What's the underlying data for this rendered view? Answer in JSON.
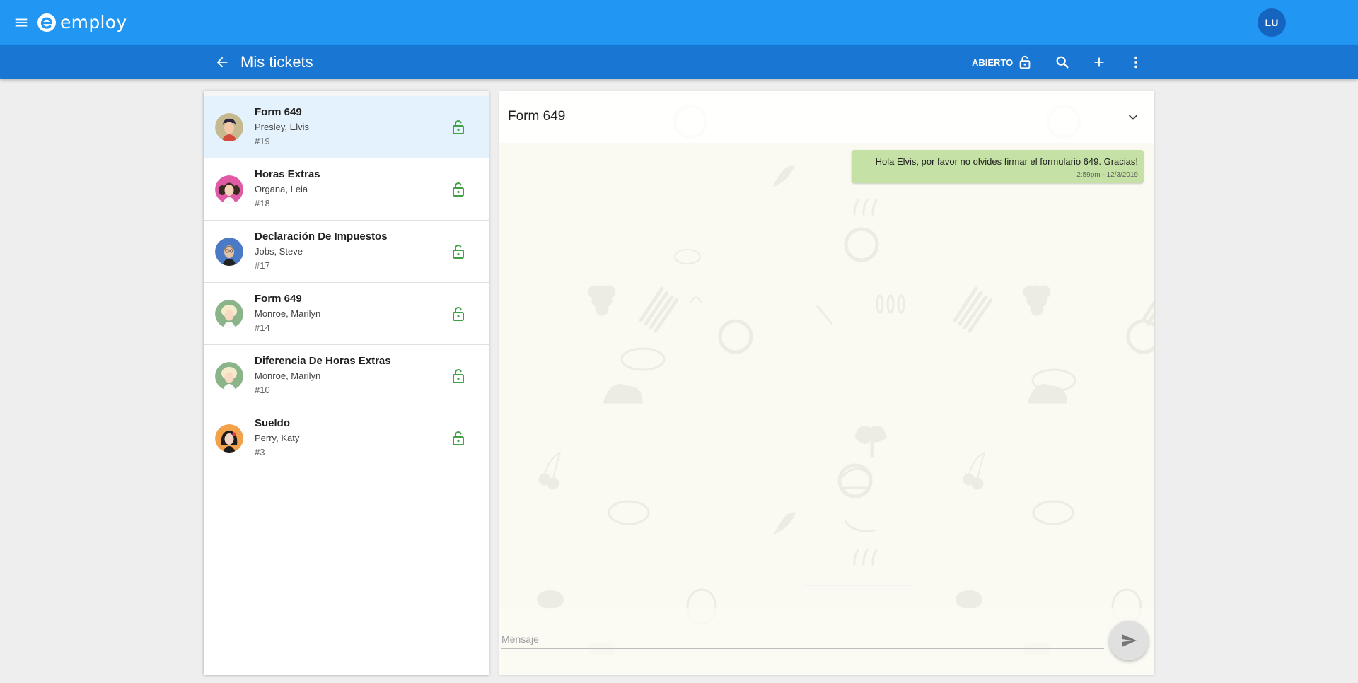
{
  "app": {
    "brand": "employ",
    "user_initials": "LU",
    "colors": {
      "primary": "#2196f3",
      "primary_dark": "#1976d2",
      "accent_open": "#43a047",
      "bubble_out": "#c5e1a5"
    }
  },
  "subbar": {
    "title": "Mis tickets",
    "status_label": "ABIERTO",
    "icons": [
      "back-arrow-icon",
      "lock-open-icon",
      "search-icon",
      "add-icon",
      "more-vert-icon"
    ]
  },
  "tickets": [
    {
      "subject": "Form 649",
      "person": "Presley, Elvis",
      "number": "#19",
      "avatar_color": "#c7b98f",
      "status_icon": "lock-open-icon",
      "selected": true
    },
    {
      "subject": "Horas Extras",
      "person": "Organa, Leia",
      "number": "#18",
      "avatar_color": "#e05aa6",
      "status_icon": "lock-open-icon"
    },
    {
      "subject": "Declaración De Impuestos",
      "person": "Jobs, Steve",
      "number": "#17",
      "avatar_color": "#4a79c6",
      "status_icon": "lock-open-icon"
    },
    {
      "subject": "Form 649",
      "person": "Monroe, Marilyn",
      "number": "#14",
      "avatar_color": "#8bb48a",
      "status_icon": "lock-open-icon"
    },
    {
      "subject": "Diferencia De Horas Extras",
      "person": "Monroe, Marilyn",
      "number": "#10",
      "avatar_color": "#8bb48a",
      "status_icon": "lock-open-icon"
    },
    {
      "subject": "Sueldo",
      "person": "Perry, Katy",
      "number": "#3",
      "avatar_color": "#f1a24b",
      "status_icon": "lock-open-icon"
    }
  ],
  "chat": {
    "title": "Form 649",
    "messages": [
      {
        "text": "Hola Elvis, por favor no olvides firmar el formulario 649. Gracias!",
        "time": "2:59pm - 12/3/2019",
        "direction": "out"
      }
    ],
    "composer": {
      "placeholder": "Mensaje",
      "value": ""
    }
  }
}
